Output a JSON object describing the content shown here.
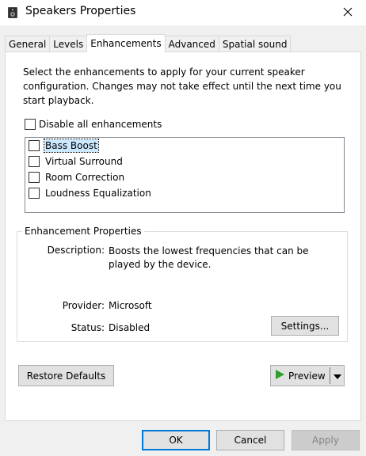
{
  "window": {
    "title": "Speakers Properties",
    "icon": "speaker-icon",
    "close_glyph": "✕"
  },
  "tabs": [
    {
      "label": "General",
      "active": false
    },
    {
      "label": "Levels",
      "active": false
    },
    {
      "label": "Enhancements",
      "active": true
    },
    {
      "label": "Advanced",
      "active": false
    },
    {
      "label": "Spatial sound",
      "active": false
    }
  ],
  "enhancements": {
    "description": "Select the enhancements to apply for your current speaker configuration. Changes may not take effect until the next time you start playback.",
    "disable_all_label": "Disable all enhancements",
    "disable_all_checked": false,
    "items": [
      {
        "label": "Bass Boost",
        "checked": false,
        "selected": true
      },
      {
        "label": "Virtual Surround",
        "checked": false,
        "selected": false
      },
      {
        "label": "Room Correction",
        "checked": false,
        "selected": false
      },
      {
        "label": "Loudness Equalization",
        "checked": false,
        "selected": false
      }
    ]
  },
  "properties": {
    "group_title": "Enhancement Properties",
    "description_label": "Description:",
    "description_value": "Boosts the lowest frequencies that can be played by the device.",
    "provider_label": "Provider:",
    "provider_value": "Microsoft",
    "status_label": "Status:",
    "status_value": "Disabled",
    "settings_button": "Settings..."
  },
  "buttons": {
    "restore_defaults": "Restore Defaults",
    "preview": "Preview",
    "ok": "OK",
    "cancel": "Cancel",
    "apply": "Apply"
  },
  "colors": {
    "accent": "#0078d7",
    "play_green": "#2e9e2e",
    "selection": "#cce8ff"
  }
}
